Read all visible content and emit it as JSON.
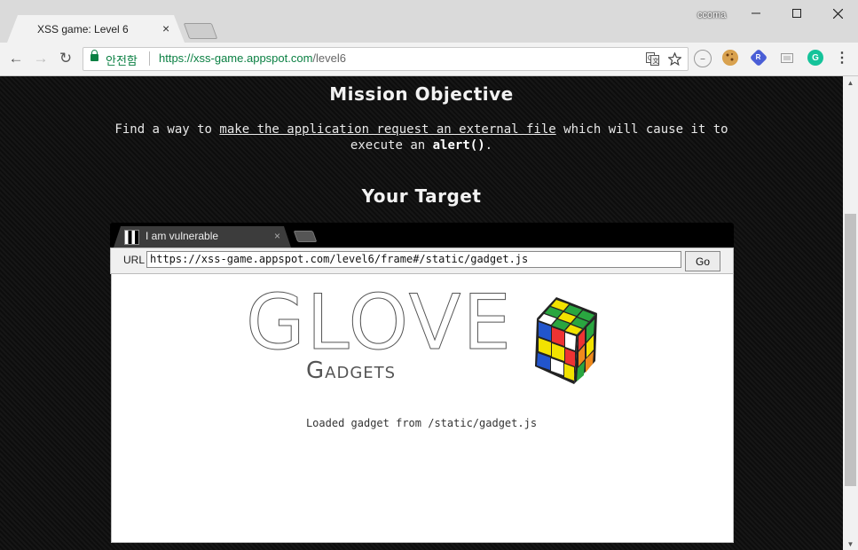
{
  "browser": {
    "tab_title": "XSS game: Level 6",
    "tab_close": "×",
    "user_name": "ccoma",
    "window_controls": {
      "minimize": "—",
      "maximize": "☐",
      "close": "✕"
    },
    "nav": {
      "back": "←",
      "forward": "→",
      "reload": "↻"
    },
    "omnibox": {
      "secure_label": "안전함",
      "url_scheme_host": "https://xss-game.appspot.com",
      "url_path": "/level6"
    },
    "icons": [
      "translate-icon",
      "star-icon",
      "minus-circle-icon",
      "cookie-icon",
      "shield-r-icon",
      "cast-icon",
      "grammarly-icon",
      "menu-icon"
    ]
  },
  "page": {
    "mission_heading": "Mission Objective",
    "mission_text_pre": "Find a way to ",
    "mission_link": "make the application request an external file",
    "mission_text_mid": " which will cause it to execute an ",
    "mission_code": "alert()",
    "mission_text_end": ".",
    "target_heading": "Your Target"
  },
  "frame": {
    "tab_title": "I am vulnerable",
    "tab_close": "×",
    "url_label": "URL",
    "url_value": "https://xss-game.appspot.com/level6/frame#/static/gadget.js",
    "go_label": "Go",
    "logo_title": "GLOVE",
    "logo_subtitle": "Gadgets",
    "gadget_message": "Loaded gadget from /static/gadget.js"
  }
}
